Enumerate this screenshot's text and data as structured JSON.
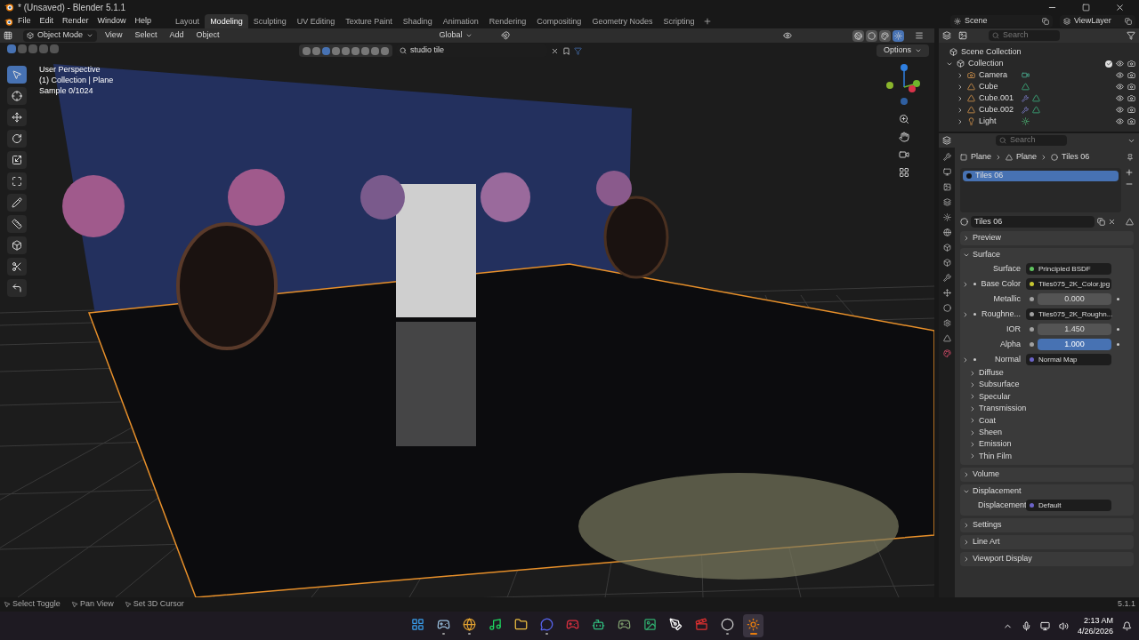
{
  "title_bar": {
    "title": "* (Unsaved) - Blender 5.1.1"
  },
  "menu": [
    "File",
    "Edit",
    "Render",
    "Window",
    "Help"
  ],
  "workspaces": [
    {
      "label": "Layout",
      "selected": false
    },
    {
      "label": "Modeling",
      "selected": true
    },
    {
      "label": "Sculpting",
      "selected": false
    },
    {
      "label": "UV Editing",
      "selected": false
    },
    {
      "label": "Texture Paint",
      "selected": false
    },
    {
      "label": "Shading",
      "selected": false
    },
    {
      "label": "Animation",
      "selected": false
    },
    {
      "label": "Rendering",
      "selected": false
    },
    {
      "label": "Compositing",
      "selected": false
    },
    {
      "label": "Geometry Nodes",
      "selected": false
    },
    {
      "label": "Scripting",
      "selected": false
    }
  ],
  "scene": {
    "scene": "Scene",
    "view_layer": "ViewLayer"
  },
  "viewport": {
    "mode": "Object Mode",
    "menus": [
      "View",
      "Select",
      "Add",
      "Object"
    ],
    "orientation": "Global",
    "search": "studio tile",
    "options": "Options",
    "overlay": [
      "User Perspective",
      "(1) Collection | Plane",
      "Sample 0/1024"
    ],
    "shading": [
      {
        "kind": "wireframe",
        "selected": false
      },
      {
        "kind": "solid",
        "selected": false
      },
      {
        "kind": "material",
        "selected": false
      },
      {
        "kind": "rendered",
        "selected": true
      }
    ],
    "tools": [
      {
        "kind": "select",
        "selected": true
      },
      {
        "kind": "cursor",
        "selected": false
      },
      {
        "kind": "move",
        "selected": false
      },
      {
        "kind": "rotate",
        "selected": false
      },
      {
        "kind": "scale",
        "selected": false
      },
      {
        "kind": "transform",
        "selected": false
      },
      {
        "kind": "annotate",
        "selected": false
      },
      {
        "kind": "measure",
        "selected": false
      },
      {
        "kind": "add",
        "selected": false
      },
      {
        "kind": "shear",
        "selected": false
      },
      {
        "kind": "corner",
        "selected": false
      }
    ]
  },
  "outliner": {
    "search_placeholder": "Search",
    "root": "Scene Collection",
    "collections": [
      {
        "name": "Collection",
        "expanded": true,
        "checked": true,
        "children": [
          {
            "name": "Camera",
            "kind": "camera"
          },
          {
            "name": "Cube",
            "kind": "mesh"
          },
          {
            "name": "Cube.001",
            "kind": "mesh_mod"
          },
          {
            "name": "Cube.002",
            "kind": "mesh_mod"
          },
          {
            "name": "Light",
            "kind": "light"
          }
        ]
      }
    ]
  },
  "properties": {
    "search_placeholder": "Search",
    "breadcrumb": [
      "Plane",
      "Plane",
      "Tiles 06"
    ],
    "slots": [
      {
        "name": "Tiles 06",
        "selected": true
      }
    ],
    "material": "Tiles 06",
    "panels": [
      {
        "title": "Preview",
        "expanded": false
      },
      {
        "title": "Surface",
        "expanded": true,
        "rows": [
          {
            "kind": "link",
            "label": "Surface",
            "value": "Principled BSDF",
            "color": "#5fc35f",
            "expandable": false
          },
          {
            "kind": "link",
            "label": "Base Color",
            "value": "Tiles075_2K_Color.jpg",
            "color": "#c7c732",
            "expandable": true
          },
          {
            "kind": "value",
            "label": "Metallic",
            "value": "0.000",
            "active": false
          },
          {
            "kind": "link",
            "label": "Roughne...",
            "value": "Tiles075_2K_Roughn...",
            "color": "#a1a1a1",
            "expandable": true
          },
          {
            "kind": "value",
            "label": "IOR",
            "value": "1.450",
            "active": false
          },
          {
            "kind": "value",
            "label": "Alpha",
            "value": "1.000",
            "active": true
          },
          {
            "kind": "link",
            "label": "Normal",
            "value": "Normal Map",
            "color": "#6b63c7",
            "expandable": true
          }
        ],
        "subpanels": [
          "Diffuse",
          "Subsurface",
          "Specular",
          "Transmission",
          "Coat",
          "Sheen",
          "Emission",
          "Thin Film"
        ]
      },
      {
        "title": "Volume",
        "expanded": false
      },
      {
        "title": "Displacement",
        "expanded": true,
        "rows": [
          {
            "kind": "link",
            "label": "Displacement",
            "value": "Default",
            "color": "#6b63c7",
            "expandable": false
          }
        ]
      },
      {
        "title": "Settings",
        "expanded": false
      },
      {
        "title": "Line Art",
        "expanded": false
      },
      {
        "title": "Viewport Display",
        "expanded": false
      }
    ]
  },
  "status_bar": {
    "hints": [
      "Select Toggle",
      "Pan View",
      "Set 3D Cursor"
    ],
    "version": "5.1.1"
  },
  "taskbar": {
    "apps": [
      {
        "kind": "start",
        "running": false,
        "selected": false
      },
      {
        "kind": "steam",
        "running": true,
        "selected": false
      },
      {
        "kind": "browser",
        "running": true,
        "selected": false
      },
      {
        "kind": "music",
        "running": false,
        "selected": false
      },
      {
        "kind": "folder",
        "running": false,
        "selected": false
      },
      {
        "kind": "chat",
        "running": true,
        "selected": false
      },
      {
        "kind": "game",
        "running": false,
        "selected": false
      },
      {
        "kind": "robot",
        "running": false,
        "selected": false
      },
      {
        "kind": "controller",
        "running": false,
        "selected": false
      },
      {
        "kind": "photo",
        "running": false,
        "selected": false
      },
      {
        "kind": "writer",
        "running": false,
        "selected": false
      },
      {
        "kind": "studio",
        "running": false,
        "selected": false
      },
      {
        "kind": "record",
        "running": true,
        "selected": false
      },
      {
        "kind": "blender",
        "running": true,
        "selected": true
      }
    ],
    "time": "2:13 AM",
    "date": "4/26/2026"
  }
}
